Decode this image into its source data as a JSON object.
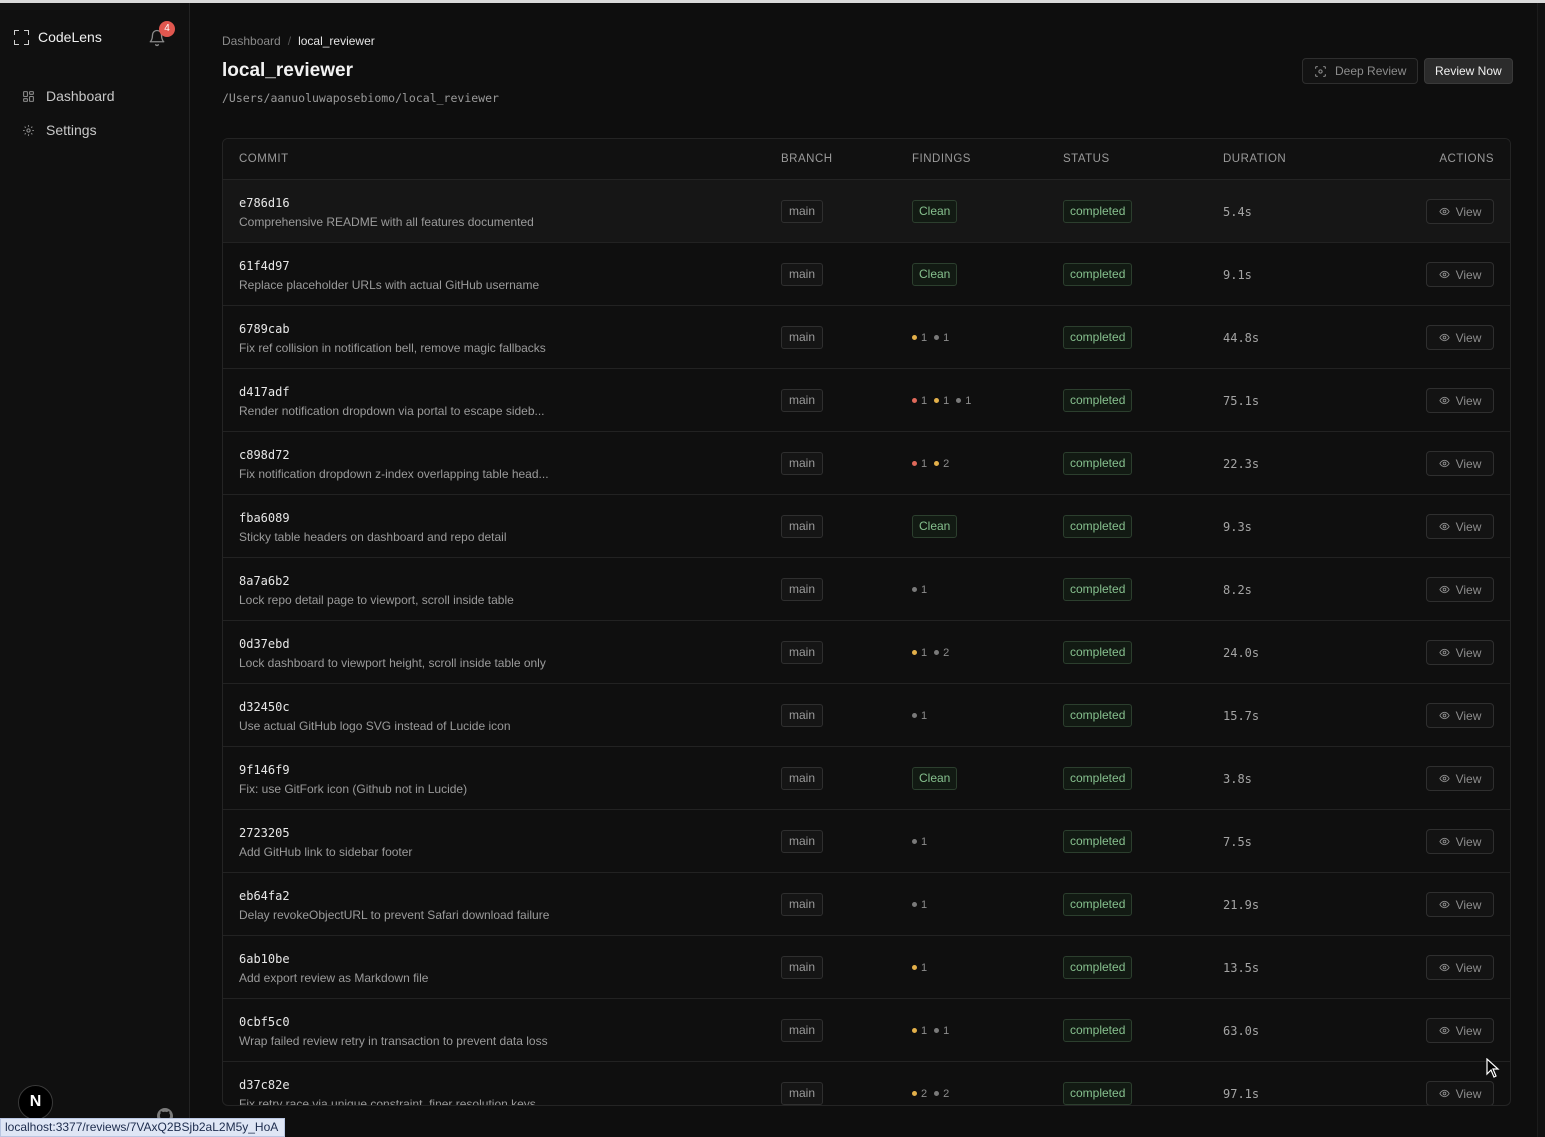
{
  "app": {
    "name": "CodeLens",
    "notification_count": "4"
  },
  "sidebar": {
    "items": [
      {
        "label": "Dashboard",
        "icon": "grid-icon"
      },
      {
        "label": "Settings",
        "icon": "gear-icon"
      }
    ],
    "avatar_letter": "N"
  },
  "breadcrumb": {
    "root": "Dashboard",
    "separator": "/",
    "current": "local_reviewer"
  },
  "page": {
    "title": "local_reviewer",
    "path": "/Users/aanuoluwaposebiomo/local_reviewer"
  },
  "actions": {
    "deep_review": "Deep Review",
    "review_now": "Review Now"
  },
  "table": {
    "headers": {
      "commit": "COMMIT",
      "branch": "BRANCH",
      "findings": "FINDINGS",
      "status": "STATUS",
      "duration": "DURATION",
      "actions": "ACTIONS"
    },
    "view_label": "View",
    "rows": [
      {
        "hash": "e786d16",
        "message": "Comprehensive README with all features documented",
        "branch": "main",
        "findings": "Clean",
        "status": "completed",
        "duration": "5.4s"
      },
      {
        "hash": "61f4d97",
        "message": "Replace placeholder URLs with actual GitHub username",
        "branch": "main",
        "findings": "Clean",
        "status": "completed",
        "duration": "9.1s"
      },
      {
        "hash": "6789cab",
        "message": "Fix ref collision in notification bell, remove magic fallbacks",
        "branch": "main",
        "findings": [
          {
            "severity": "warning",
            "count": "1"
          },
          {
            "severity": "info",
            "count": "1"
          }
        ],
        "status": "completed",
        "duration": "44.8s"
      },
      {
        "hash": "d417adf",
        "message": "Render notification dropdown via portal to escape sideb...",
        "branch": "main",
        "findings": [
          {
            "severity": "critical",
            "count": "1"
          },
          {
            "severity": "warning",
            "count": "1"
          },
          {
            "severity": "info",
            "count": "1"
          }
        ],
        "status": "completed",
        "duration": "75.1s"
      },
      {
        "hash": "c898d72",
        "message": "Fix notification dropdown z-index overlapping table head...",
        "branch": "main",
        "findings": [
          {
            "severity": "critical",
            "count": "1"
          },
          {
            "severity": "warning",
            "count": "2"
          }
        ],
        "status": "completed",
        "duration": "22.3s"
      },
      {
        "hash": "fba6089",
        "message": "Sticky table headers on dashboard and repo detail",
        "branch": "main",
        "findings": "Clean",
        "status": "completed",
        "duration": "9.3s"
      },
      {
        "hash": "8a7a6b2",
        "message": "Lock repo detail page to viewport, scroll inside table",
        "branch": "main",
        "findings": [
          {
            "severity": "info",
            "count": "1"
          }
        ],
        "status": "completed",
        "duration": "8.2s"
      },
      {
        "hash": "0d37ebd",
        "message": "Lock dashboard to viewport height, scroll inside table only",
        "branch": "main",
        "findings": [
          {
            "severity": "warning",
            "count": "1"
          },
          {
            "severity": "info",
            "count": "2"
          }
        ],
        "status": "completed",
        "duration": "24.0s"
      },
      {
        "hash": "d32450c",
        "message": "Use actual GitHub logo SVG instead of Lucide icon",
        "branch": "main",
        "findings": [
          {
            "severity": "info",
            "count": "1"
          }
        ],
        "status": "completed",
        "duration": "15.7s"
      },
      {
        "hash": "9f146f9",
        "message": "Fix: use GitFork icon (Github not in Lucide)",
        "branch": "main",
        "findings": "Clean",
        "status": "completed",
        "duration": "3.8s"
      },
      {
        "hash": "2723205",
        "message": "Add GitHub link to sidebar footer",
        "branch": "main",
        "findings": [
          {
            "severity": "info",
            "count": "1"
          }
        ],
        "status": "completed",
        "duration": "7.5s"
      },
      {
        "hash": "eb64fa2",
        "message": "Delay revokeObjectURL to prevent Safari download failure",
        "branch": "main",
        "findings": [
          {
            "severity": "info",
            "count": "1"
          }
        ],
        "status": "completed",
        "duration": "21.9s"
      },
      {
        "hash": "6ab10be",
        "message": "Add export review as Markdown file",
        "branch": "main",
        "findings": [
          {
            "severity": "warning",
            "count": "1"
          }
        ],
        "status": "completed",
        "duration": "13.5s"
      },
      {
        "hash": "0cbf5c0",
        "message": "Wrap failed review retry in transaction to prevent data loss",
        "branch": "main",
        "findings": [
          {
            "severity": "warning",
            "count": "1"
          },
          {
            "severity": "info",
            "count": "1"
          }
        ],
        "status": "completed",
        "duration": "63.0s"
      },
      {
        "hash": "d37c82e",
        "message": "Fix retry race via unique constraint, finer resolution keys",
        "branch": "main",
        "findings": [
          {
            "severity": "warning",
            "count": "2"
          },
          {
            "severity": "info",
            "count": "2"
          }
        ],
        "status": "completed",
        "duration": "97.1s"
      }
    ]
  },
  "colors": {
    "critical": "#e0695a",
    "warning": "#e3b04a",
    "info": "#7a7a7a",
    "success": "#86c08e",
    "badge_red": "#e0574f"
  },
  "status_bar_url": "localhost:3377/reviews/7VAxQ2BSjb2aL2M5y_HoA"
}
